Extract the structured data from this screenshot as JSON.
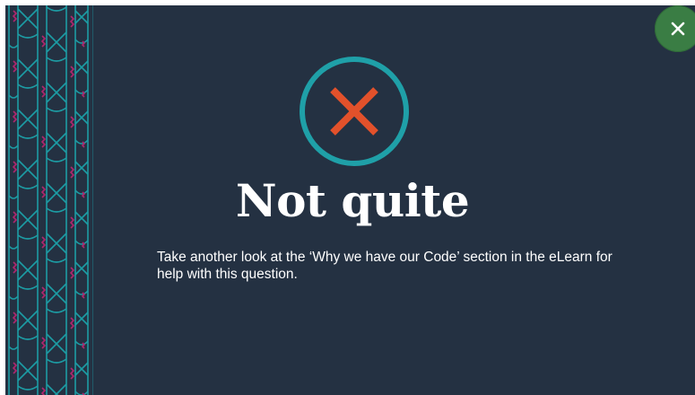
{
  "feedback": {
    "title": "Not quite",
    "message": "Take another look at the ‘Why we have our Code’ section in the eLearn for help with this question.",
    "result_icon": "x-mark-icon",
    "close_icon": "close-icon"
  },
  "colors": {
    "panel_background": "#243142",
    "ring": "#1fa0a8",
    "x_mark": "#e2512b",
    "close_button": "#3a7d44",
    "pattern_teal": "#1c9ca4",
    "pattern_magenta": "#b0266e",
    "text": "#ffffff"
  }
}
